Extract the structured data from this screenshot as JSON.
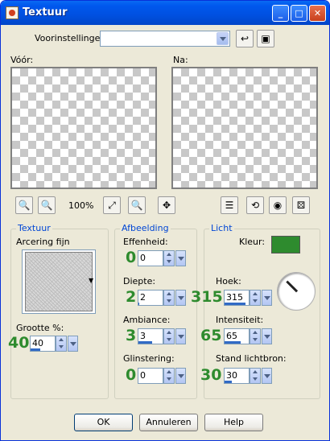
{
  "window": {
    "title": "Textuur",
    "controls": [
      "_",
      "□",
      "✕"
    ]
  },
  "presets": {
    "label": "Voorinstellingen:",
    "value": "",
    "icons": [
      "arrow-icon",
      "save-icon"
    ]
  },
  "previews": {
    "before_label": "Vóór:",
    "after_label": "Na:"
  },
  "toolbar": {
    "zoom": "100%",
    "icons": [
      "zoom-out-icon",
      "zoom-in-icon",
      "fit-icon",
      "grayed-icon",
      "move-icon",
      "list-icon",
      "reset-icon",
      "eye-icon",
      "dice-icon"
    ]
  },
  "texture": {
    "group_title": "Textuur",
    "name": "Arcering fijn",
    "size_label": "Grootte %:",
    "size_value": "40",
    "size_big": "40",
    "size_fill": 0.4
  },
  "image": {
    "group_title": "Afbeelding",
    "fields": [
      {
        "label": "Effenheid:",
        "value": "0",
        "big": "0",
        "fill": 0
      },
      {
        "label": "Diepte:",
        "value": "2",
        "big": "2",
        "fill": 0.03
      },
      {
        "label": "Ambiance:",
        "value": "3",
        "big": "3",
        "fill": 0.55
      },
      {
        "label": "Glinstering:",
        "value": "0",
        "big": "0",
        "fill": 0
      }
    ]
  },
  "light": {
    "group_title": "Licht",
    "color_label": "Kleur:",
    "color": "#2e8b2e",
    "fields": [
      {
        "label": "Hoek:",
        "value": "315",
        "big": "315",
        "fill": 0.87
      },
      {
        "label": "Intensiteit:",
        "value": "65",
        "big": "65",
        "fill": 0.65
      },
      {
        "label": "Stand lichtbron:",
        "value": "30",
        "big": "30",
        "fill": 0.3
      }
    ],
    "angle": 315
  },
  "buttons": {
    "ok": "OK",
    "cancel": "Annuleren",
    "help": "Help"
  },
  "colors": {
    "accent": "#2e8b2e",
    "titlebar": "#0058ee",
    "group_title": "#0046d5"
  }
}
